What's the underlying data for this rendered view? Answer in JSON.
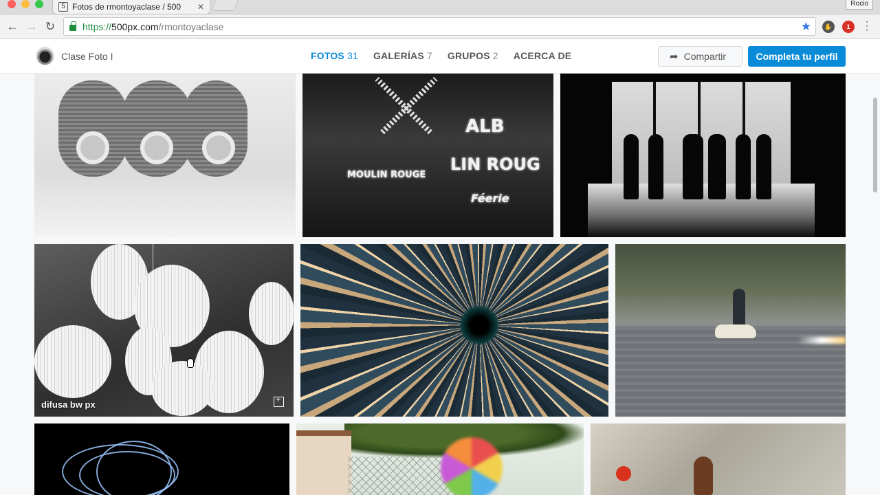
{
  "browser": {
    "tab_title": "Fotos de rmontoyaclase / 500",
    "tab_close": "✕",
    "user_button": "Rocio",
    "url_scheme": "https://",
    "url_host": "500px.com",
    "url_path": "/rmontoyaclase",
    "ext_badge": "1"
  },
  "header": {
    "user_name": "Clase Foto I",
    "tabs": [
      {
        "label": "FOTOS",
        "count": "31"
      },
      {
        "label": "GALERÍAS",
        "count": "7"
      },
      {
        "label": "GRUPOS",
        "count": "2"
      },
      {
        "label": "ACERCA DE",
        "count": ""
      }
    ],
    "share_label": "Compartir",
    "profile_label": "Completa tu perfil"
  },
  "photos": {
    "spools_sign": "",
    "moulin_sign_1": "MOULIN ROUGE",
    "moulin_sign_2": "ALB",
    "moulin_sign_3": "LIN ROUG",
    "moulin_sign_4": "Féerie",
    "lamps_caption": "difusa bw px"
  },
  "colors": {
    "accent": "#0a8bd8",
    "secure": "#1e8e3e"
  }
}
